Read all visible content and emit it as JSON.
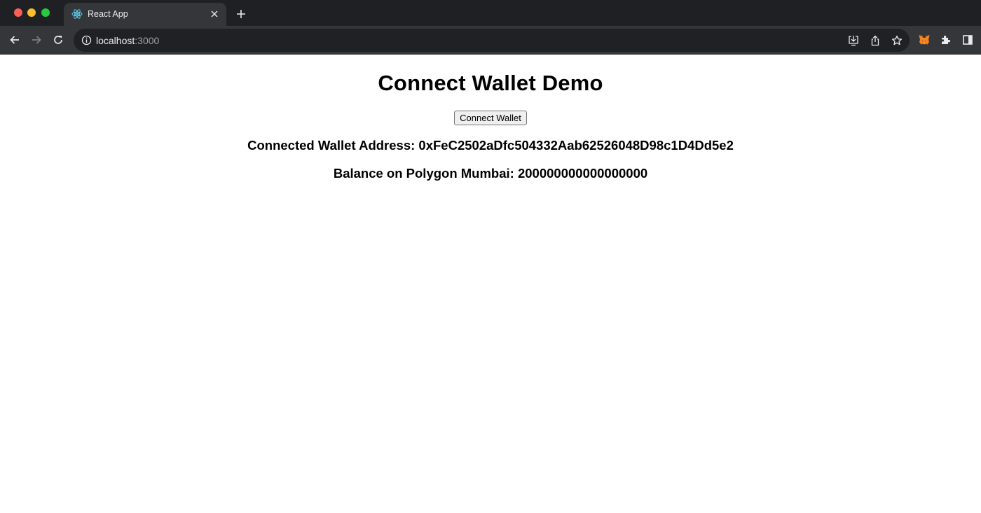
{
  "browser": {
    "tab": {
      "title": "React App",
      "favicon": "react-logo-icon"
    },
    "address_bar": {
      "host": "localhost",
      "port": ":3000"
    },
    "icons": {
      "back": "arrow-left-icon",
      "forward": "arrow-right-icon",
      "reload": "reload-icon",
      "site_info": "info-icon",
      "install": "install-app-icon",
      "share": "share-icon",
      "bookmark": "star-icon",
      "metamask": "metamask-fox-icon",
      "extensions": "puzzle-icon",
      "side_panel": "side-panel-icon"
    },
    "colors": {
      "tabstrip": "#1f2023",
      "toolbar": "#35363a",
      "omnibox": "#202124"
    }
  },
  "page": {
    "title": "Connect Wallet Demo",
    "connect_button_label": "Connect Wallet",
    "address_line": "Connected Wallet Address: 0xFeC2502aDfc504332Aab62526048D98c1D4Dd5e2",
    "balance_line": "Balance on Polygon Mumbai: 200000000000000000"
  }
}
